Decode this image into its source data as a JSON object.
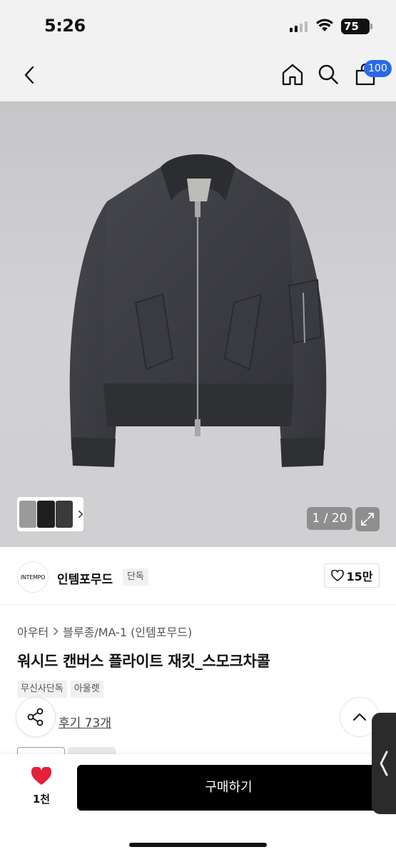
{
  "status_bar": {
    "time": "5:26",
    "battery": "75"
  },
  "nav": {
    "cart_count": "100"
  },
  "gallery": {
    "counter": "1 / 20",
    "thumbnail_colors": [
      "#9a9a9a",
      "#1f1f1f",
      "#3a3a3a"
    ]
  },
  "brand": {
    "logo_text": "INTEMPO",
    "name": "인템포무드",
    "badge": "단독",
    "like_count": "15만"
  },
  "product": {
    "breadcrumb": [
      "아우터",
      "블루종/MA-1 (인템포무드)"
    ],
    "title": "워시드 캔버스 플라이트 재킷_스모크차콜",
    "tags": [
      "무신사단독",
      "아울렛"
    ],
    "review_link": "후기 73개"
  },
  "bottom_bar": {
    "like_count": "1천",
    "buy_label": "구매하기"
  },
  "colors": {
    "accent": "#2a6ae8",
    "heart": "#e5203a",
    "jacket": "#3c3d42"
  }
}
